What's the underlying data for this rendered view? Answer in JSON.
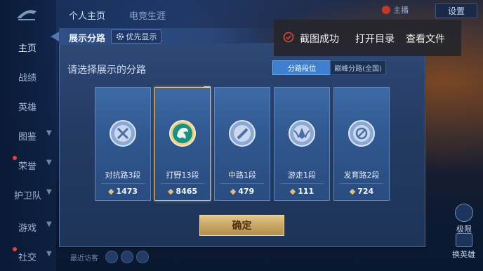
{
  "top_tabs": [
    {
      "label": "个人主页",
      "active": true
    },
    {
      "label": "电竞生涯",
      "active": false
    }
  ],
  "top_right": {
    "settings_label": "设置",
    "user_mini": "主播"
  },
  "sidebar": {
    "items": [
      {
        "label": "主页",
        "active": true,
        "has_chevron": false,
        "badge": false
      },
      {
        "label": "战绩",
        "active": false,
        "has_chevron": false,
        "badge": false
      },
      {
        "label": "英雄",
        "active": false,
        "has_chevron": false,
        "badge": false
      },
      {
        "label": "图鉴",
        "active": false,
        "has_chevron": true,
        "badge": false
      },
      {
        "label": "荣誉",
        "active": false,
        "has_chevron": true,
        "badge": true
      },
      {
        "label": "护卫队",
        "active": false,
        "has_chevron": true,
        "badge": false
      },
      {
        "label": "游戏",
        "active": false,
        "has_chevron": true,
        "badge": false
      },
      {
        "label": "社交",
        "active": false,
        "has_chevron": true,
        "badge": true
      }
    ]
  },
  "modal": {
    "title": "展示分路",
    "priority_button": "优先显示",
    "subtitle": "请选择展示的分路",
    "segments": [
      {
        "label": "分路段位",
        "active": true
      },
      {
        "label": "巅峰分路(全国)",
        "active": false
      }
    ],
    "cards": [
      {
        "name": "对抗路3段",
        "points": "1473",
        "icon": "shield-sword-emblem-icon",
        "selected": false
      },
      {
        "name": "打野13段",
        "points": "8465",
        "icon": "jungle-dragon-emblem-icon",
        "selected": true
      },
      {
        "name": "中路1段",
        "points": "479",
        "icon": "mid-lane-emblem-icon",
        "selected": false
      },
      {
        "name": "游走1段",
        "points": "111",
        "icon": "roam-wings-emblem-icon",
        "selected": false
      },
      {
        "name": "发育路2段",
        "points": "724",
        "icon": "bow-target-emblem-icon",
        "selected": false
      }
    ],
    "confirm_label": "确定"
  },
  "toast": {
    "message": "截图成功",
    "action_open_dir": "打开目录",
    "action_view_file": "查看文件"
  },
  "right_side": {
    "label_1": "极限",
    "label_2": "换英雄"
  },
  "bottom": {
    "hint": "最近访客"
  },
  "colors": {
    "accent_blue": "#3f7fcf",
    "gold": "#e3c07a",
    "confirm_gold": "#c9a565",
    "toast_bg": "#26262c",
    "success_red": "#e0463a"
  }
}
